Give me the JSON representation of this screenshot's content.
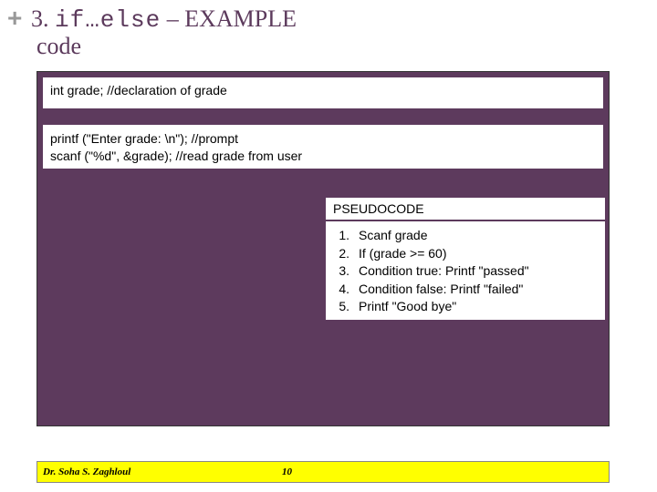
{
  "header": {
    "plus": "+",
    "title_prefix": "3. ",
    "title_mono": "if…else",
    "title_suffix": " – EXAMPLE",
    "subtitle": "code"
  },
  "code_top": "int grade; //declaration of grade",
  "code_mid_line1": "printf (\"Enter grade: \\n\"); //prompt",
  "code_mid_line2": "scanf (\"%d\", &grade); //read grade from user",
  "pseudo": {
    "heading": "PSEUDOCODE",
    "items": [
      {
        "n": "1.",
        "t": "Scanf grade"
      },
      {
        "n": "2.",
        "t": "If (grade >= 60)"
      },
      {
        "n": "3.",
        "t": "Condition true: Printf \"passed\""
      },
      {
        "n": "4.",
        "t": "Condition false: Printf \"failed\""
      },
      {
        "n": "5.",
        "t": "Printf \"Good bye\""
      }
    ]
  },
  "footer": {
    "author": "Dr. Soha S. Zaghloul",
    "page": "10"
  }
}
